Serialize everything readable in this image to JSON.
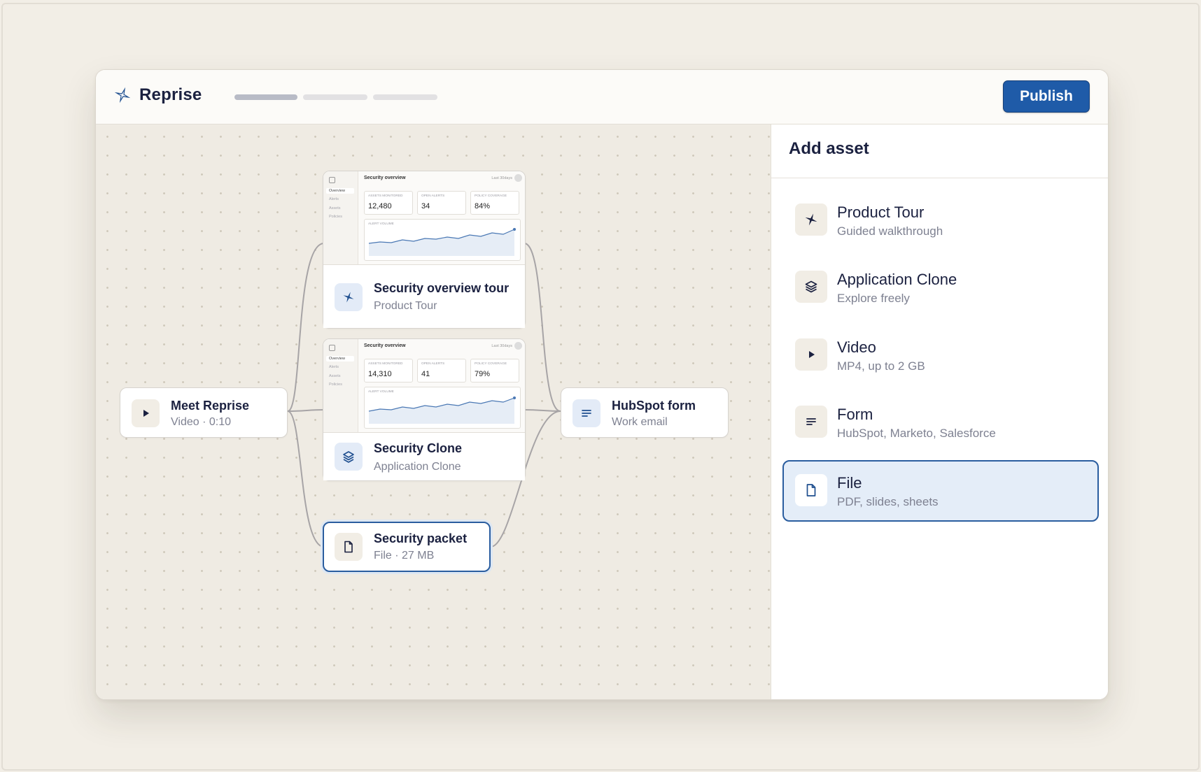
{
  "app": {
    "name": "Reprise"
  },
  "toolbar": {
    "publish_label": "Publish"
  },
  "canvas": {
    "nodes": {
      "meet": {
        "title": "Meet Reprise",
        "subtitle": "Video · 0:10"
      },
      "tour": {
        "title": "Security overview tour",
        "subtitle": "Product Tour",
        "preview": {
          "title": "Security overview",
          "range": "Last 30days",
          "nav": [
            "Overview",
            "Alerts",
            "Assets",
            "Policies"
          ],
          "kpis": [
            {
              "label": "ASSETS MONITORED",
              "value": "12,480"
            },
            {
              "label": "OPEN ALERTS",
              "value": "34"
            },
            {
              "label": "POLICY COVERAGE",
              "value": "84%"
            }
          ],
          "chart_label": "ALERT VOLUME"
        }
      },
      "clone": {
        "title": "Security Clone",
        "subtitle": "Application Clone",
        "preview": {
          "title": "Security overview",
          "range": "Last 30days",
          "nav": [
            "Overview",
            "Alerts",
            "Assets",
            "Policies"
          ],
          "kpis": [
            {
              "label": "ASSETS MONITORED",
              "value": "14,310"
            },
            {
              "label": "OPEN ALERTS",
              "value": "41"
            },
            {
              "label": "POLICY COVERAGE",
              "value": "79%"
            }
          ],
          "chart_label": "ALERT VOLUME"
        }
      },
      "packet": {
        "title": "Security packet",
        "subtitle": "File · 27 MB"
      },
      "hubspot": {
        "title": "HubSpot form",
        "subtitle": "Work email"
      }
    }
  },
  "panel": {
    "title": "Add asset",
    "items": [
      {
        "label": "Product Tour",
        "desc": "Guided walkthrough",
        "icon": "sparkle-icon"
      },
      {
        "label": "Application Clone",
        "desc": "Explore freely",
        "icon": "layers-icon"
      },
      {
        "label": "Video",
        "desc": "MP4, up to 2 GB",
        "icon": "play-icon"
      },
      {
        "label": "Form",
        "desc": "HubSpot, Marketo, Salesforce",
        "icon": "lines-icon"
      },
      {
        "label": "File",
        "desc": "PDF, slides, sheets",
        "icon": "file-icon"
      }
    ],
    "selected_index": 4
  },
  "colors": {
    "accent": "#1f5ba8",
    "selected_bg": "#e4edf8",
    "canvas_bg": "#efebe3"
  }
}
